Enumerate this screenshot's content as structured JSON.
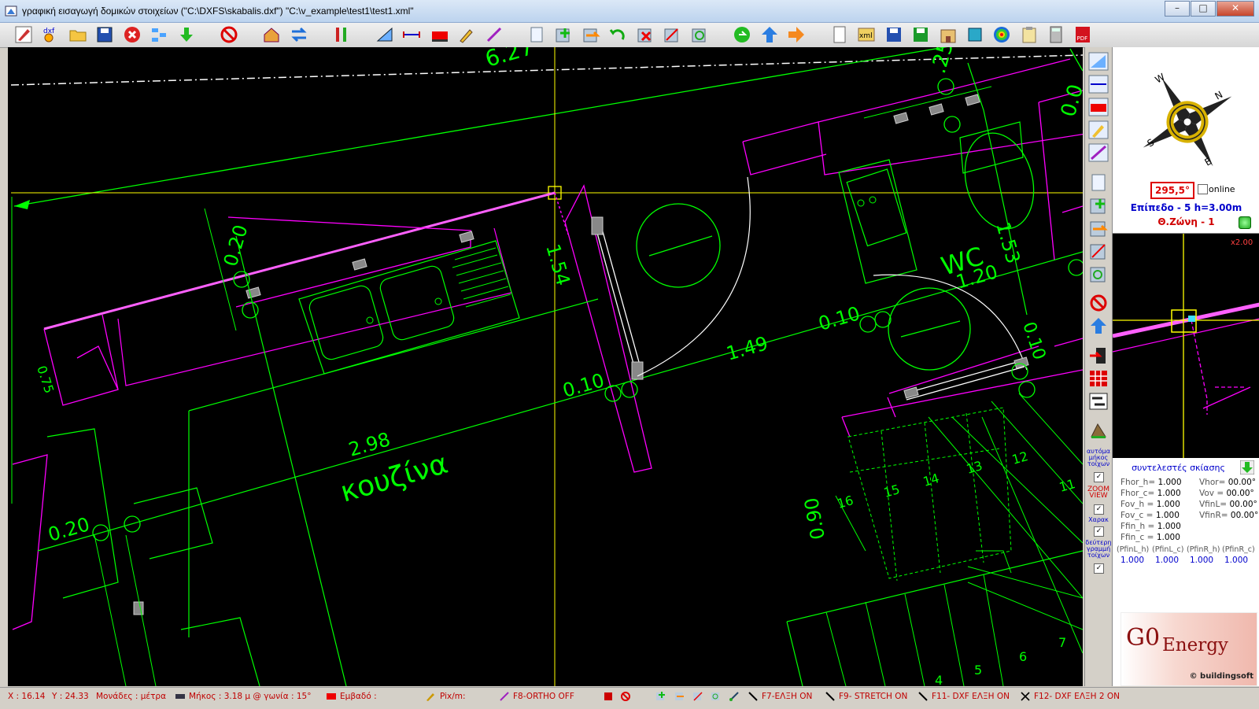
{
  "window": {
    "title": "γραφική εισαγωγή δομικών στοιχείων (\"C:\\DXFS\\skabalis.dxf\") \"C:\\v_example\\test1\\test1.xml\"",
    "minimize": "–",
    "maximize": "□",
    "close": "✕"
  },
  "toolbar_icons": [
    "edit-pen-icon",
    "dxf-icon",
    "open-folder-icon",
    "save-icon",
    "cancel-red-icon",
    "tree-icon",
    "green-down-arrow-icon",
    "no-entry-icon",
    "house-icon",
    "swap-arrows-icon",
    "tools-icon",
    "ruler-icon",
    "dimension-icon",
    "red-wall-icon",
    "pencil-icon",
    "line-tool-icon",
    "page-icon",
    "add-green-icon",
    "move-orange-icon",
    "undo-green-icon",
    "delete-red-icon",
    "stretch-icon",
    "rotate-icon",
    "go-icon",
    "up-blue-icon",
    "right-orange-icon",
    "new-page-icon",
    "xml-icon",
    "save2-icon",
    "save-green-icon",
    "building-icon",
    "layers-icon",
    "target-icon",
    "clipboard-icon",
    "calculator-icon",
    "pdf-icon"
  ],
  "drawing": {
    "dim_627": "6.27",
    "dim_025": ".25",
    "dim_005": "0.0",
    "dim_020_top": "0.20",
    "dim_154": "1.54",
    "dim_075": "0.75",
    "dim_153": "1.53",
    "dim_120": "1.20",
    "dim_010_a": "0.10",
    "dim_010_b": "0.10",
    "dim_010_c": "0.10",
    "dim_149": "1.49",
    "dim_298": "2.98",
    "dim_020_bottom": "0.20",
    "dim_090": "0.90",
    "room_kitchen": "κουζίνα",
    "room_wc": "WC",
    "steps": [
      "16",
      "15",
      "14",
      "13",
      "12",
      "11",
      "7",
      "6",
      "5",
      "4"
    ]
  },
  "right_tools": {
    "auto_wall_length": "αυτόμα μήκος τοίχων",
    "zoom_view": "ZOOM VIEW",
    "xarak": "Χαρακ",
    "second_lines": "δεύτερη γραμμή τοίχων"
  },
  "panel": {
    "compass": {
      "N": "N",
      "S": "S",
      "E": "E",
      "W": "W"
    },
    "angle": "295,5°",
    "online": "online",
    "level": "Επίπεδο - 5  h=3.00m",
    "zone": "Θ.Ζώνη - 1",
    "mini_zoom": "x2.00",
    "shade_title": "συντελεστές σκίασης",
    "coef_left": [
      {
        "k": "Fhor_h=",
        "v": "1.000"
      },
      {
        "k": "Fhor_c=",
        "v": "1.000"
      },
      {
        "k": "Fov_h =",
        "v": "1.000"
      },
      {
        "k": "Fov_c =",
        "v": "1.000"
      },
      {
        "k": "Ffin_h =",
        "v": "1.000"
      },
      {
        "k": "Ffin_c =",
        "v": "1.000"
      }
    ],
    "coef_right": [
      {
        "k": "Vhor=",
        "v": "00.00°"
      },
      {
        "k": "Vov =",
        "v": "00.00°"
      },
      {
        "k": "VfinL=",
        "v": "00.00°"
      },
      {
        "k": "VfinR=",
        "v": "00.00°"
      }
    ],
    "pf_heads": [
      "(PfinL_h)",
      "(PfinL_c)",
      "(PfinR_h)",
      "(PfinR_c)"
    ],
    "pf_vals": [
      "1.000",
      "1.000",
      "1.000",
      "1.000"
    ],
    "logo_go": "G0",
    "logo_energy": "Energy",
    "logo_bs": "© buildingsoft"
  },
  "status": {
    "x": "X : 16.14",
    "y": "Y : 24.33",
    "units": "Μονάδες : μέτρα",
    "length": "Μήκος : 3.18 μ @ γωνία :  15°",
    "area": "Εμβαδό :",
    "pixm": "Pix/m:",
    "f8": "F8-ORTHO OFF",
    "f7": "F7-ΕΛΞΗ ON",
    "f9": "F9- STRETCH ON",
    "f11": "F11- DXF ΕΛΞΗ ON",
    "f12": "F12- DXF ΕΛΞΗ 2 ON"
  },
  "colors": {
    "green": "#00ff00",
    "magenta": "#ff00ff",
    "yellow": "#ffff00",
    "white": "#ffffff",
    "canvas_bg": "#000000"
  }
}
